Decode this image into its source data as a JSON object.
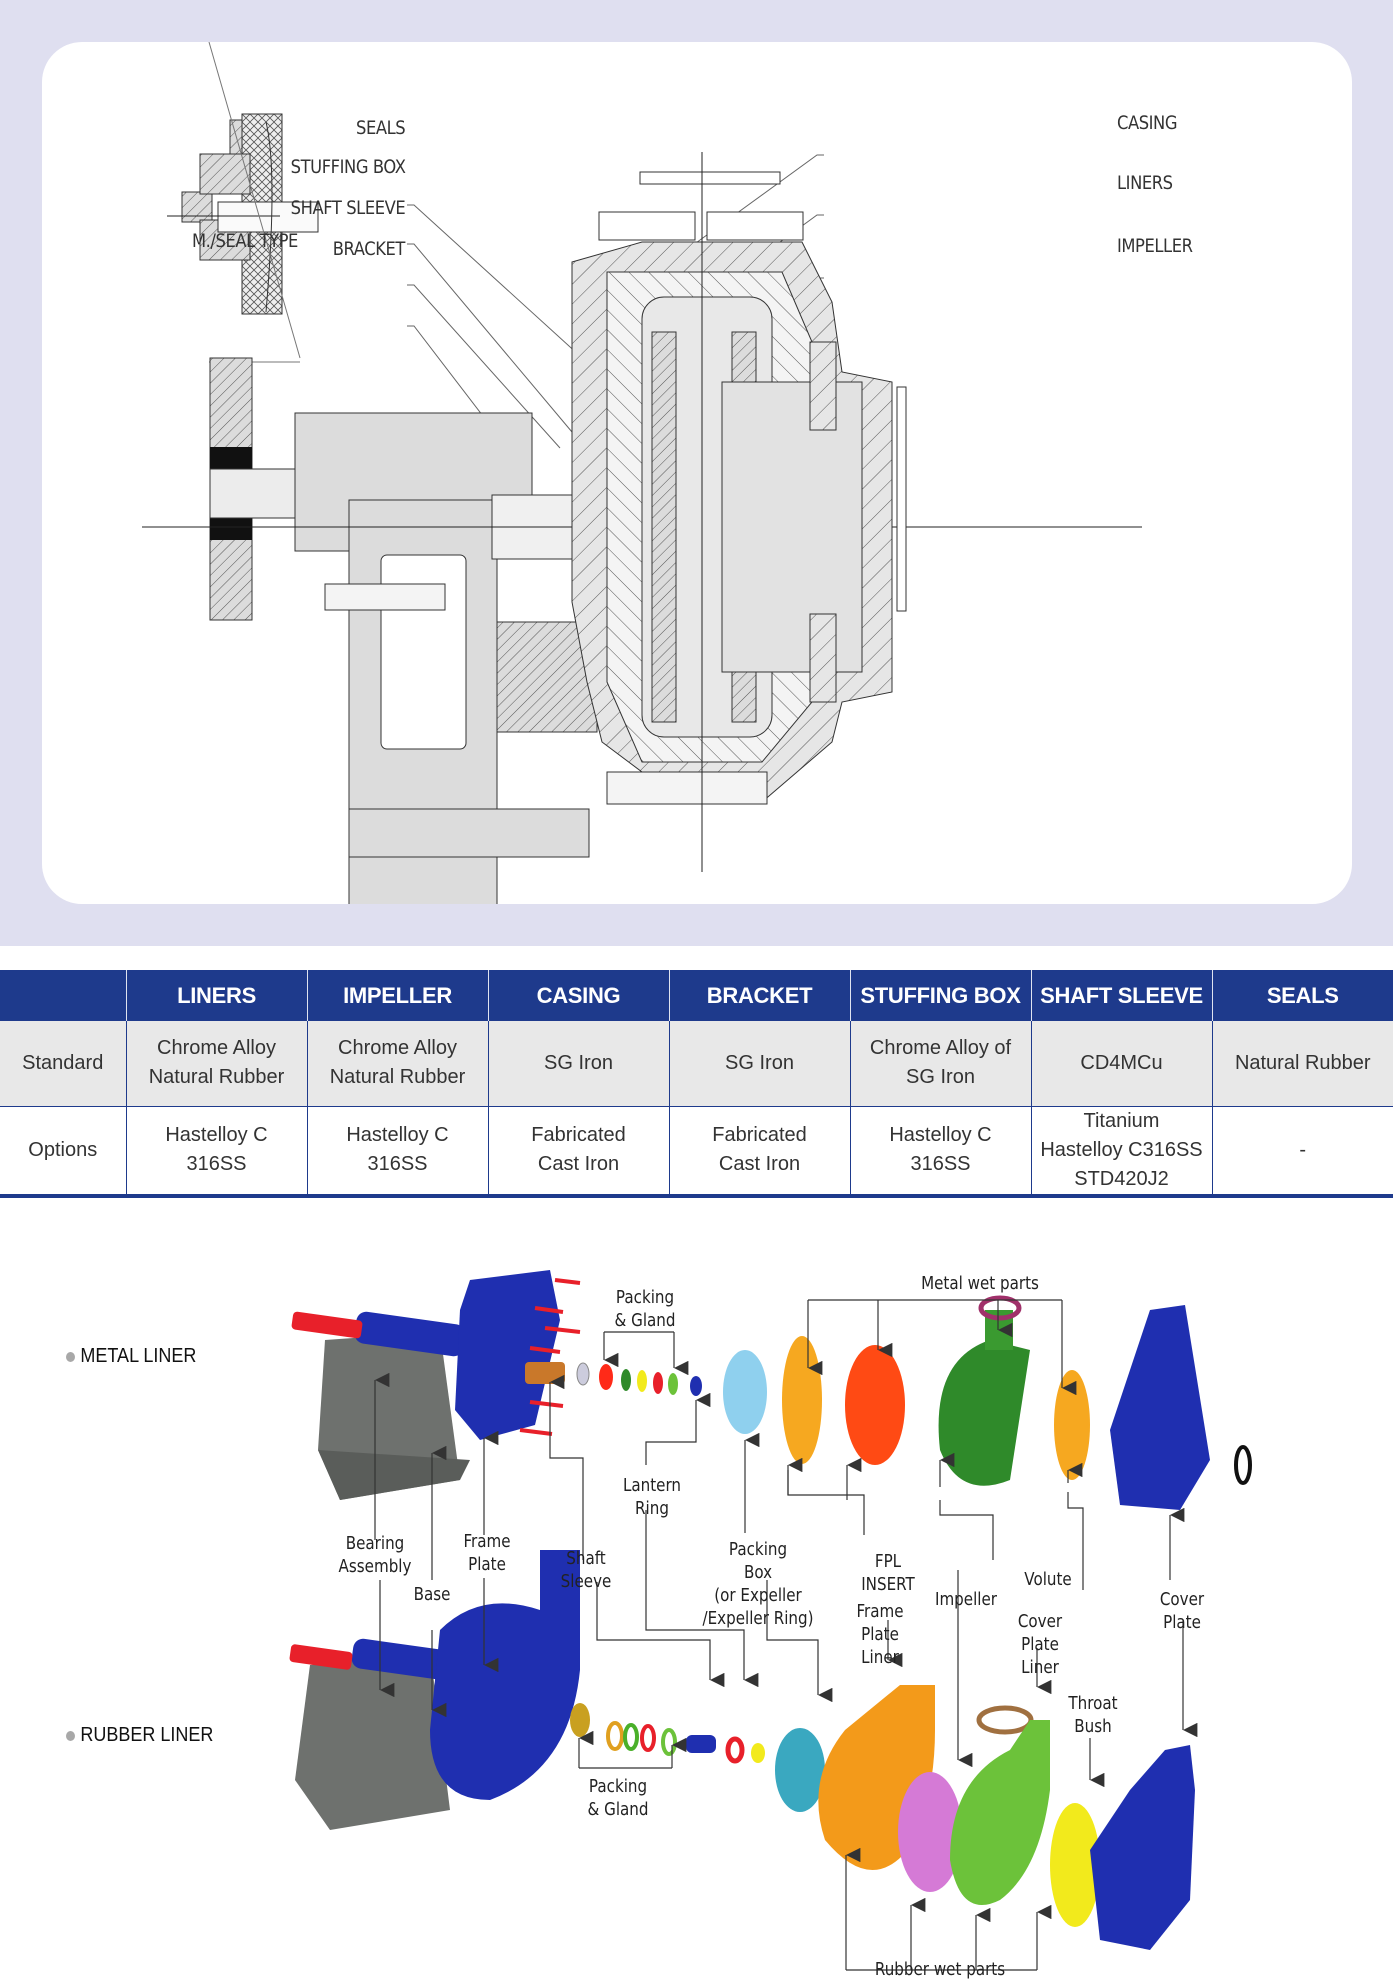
{
  "drawing": {
    "seal_inset_caption": "M./SEAL TYPE",
    "callouts_left": [
      "SEALS",
      "STUFFING BOX",
      "SHAFT SLEEVE",
      "BRACKET"
    ],
    "callouts_right": [
      "CASING",
      "LINERS",
      "IMPELLER"
    ]
  },
  "materials_table": {
    "columns": [
      "",
      "LINERS",
      "IMPELLER",
      "CASING",
      "BRACKET",
      "STUFFING BOX",
      "SHAFT SLEEVE",
      "SEALS"
    ],
    "rows": [
      {
        "label": "Standard",
        "cells": [
          [
            "Chrome Alloy",
            "Natural Rubber"
          ],
          [
            "Chrome Alloy",
            "Natural Rubber"
          ],
          [
            "SG Iron"
          ],
          [
            "SG Iron"
          ],
          [
            "Chrome Alloy of",
            "SG Iron"
          ],
          [
            "CD4MCu"
          ],
          [
            "Natural Rubber"
          ]
        ]
      },
      {
        "label": "Options",
        "cells": [
          [
            "Hastelloy C",
            "316SS"
          ],
          [
            "Hastelloy C",
            "316SS"
          ],
          [
            "Fabricated",
            "Cast Iron"
          ],
          [
            "Fabricated",
            "Cast Iron"
          ],
          [
            "Hastelloy C",
            "316SS"
          ],
          [
            "Titanium",
            "Hastelloy C316SS",
            "STD420J2"
          ],
          [
            "-"
          ]
        ]
      }
    ]
  },
  "assembly": {
    "variants": [
      "METAL LINER",
      "RUBBER LINER"
    ],
    "group_labels": {
      "metal_wet_parts": "Metal wet parts",
      "rubber_wet_parts": "Rubber wet parts",
      "packing_gland_top": [
        "Packing",
        "& Gland"
      ],
      "packing_gland_bottom": [
        "Packing",
        "& Gland"
      ]
    },
    "parts": {
      "bearing_assembly": [
        "Bearing",
        "Assembly"
      ],
      "base": [
        "Base"
      ],
      "frame_plate": [
        "Frame",
        "Plate"
      ],
      "shaft_sleeve": [
        "Shaft",
        "Sleeve"
      ],
      "lantern_ring": [
        "Lantern",
        "Ring"
      ],
      "packing_box": [
        "Packing",
        "Box",
        "(or Expeller",
        "/Expeller Ring)"
      ],
      "fpl_insert": [
        "FPL",
        "INSERT"
      ],
      "frame_plate_liner": [
        "Frame",
        "Plate",
        "Liner"
      ],
      "impeller": [
        "Impeller"
      ],
      "volute": [
        "Volute"
      ],
      "cover_plate_liner": [
        "Cover",
        "Plate",
        "Liner"
      ],
      "throat_bush": [
        "Throat",
        "Bush"
      ],
      "cover_plate": [
        "Cover",
        "Plate"
      ]
    },
    "colors": {
      "pump_blue": "#1f2fb0",
      "pedestal_gray": "#6e716e",
      "shaft_red": "#e8202a",
      "orange": "#f39a1a",
      "green": "#2f8a2a",
      "light_green": "#6cc23a",
      "yellow": "#f2ea1c",
      "cyan": "#8fd0ee",
      "teal": "#3aa8c0",
      "magenta": "#d57ad6",
      "red_orange": "#ff4a14"
    }
  }
}
